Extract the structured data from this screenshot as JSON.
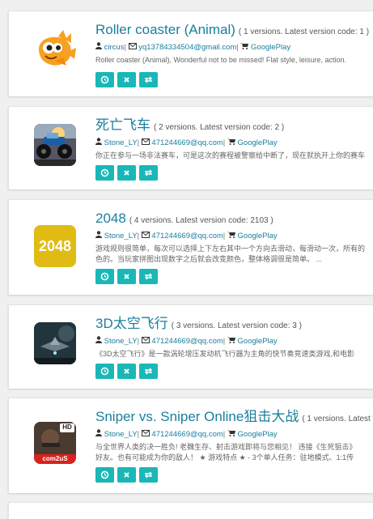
{
  "apps": [
    {
      "title": "Roller coaster (Animal)",
      "versions": "( 1 versions. Latest version code: 1 )",
      "author": "circus",
      "email": "yq13784334504@gmail.com",
      "store": "GooglePlay",
      "desc1": "Roller coaster (Animal), Wonderful not to be missed! Flat style, leisure, action.",
      "desc2": "",
      "icon": "fish-icon"
    },
    {
      "title": "死亡飞车",
      "versions": "( 2 versions. Latest version code: 2 )",
      "author": "Stone_LY",
      "email": "471244669@qq.com",
      "store": "GooglePlay",
      "desc1": "你正在参与一场非法赛车，可是这次的赛程被警察给中断了，现在就执开上你的赛车",
      "desc2": "",
      "icon": "monster-truck-icon"
    },
    {
      "title": "2048",
      "versions": "( 4 versions. Latest version code: 2103 )",
      "author": "Stone_LY",
      "email": "471244669@qq.com",
      "store": "GooglePlay",
      "desc1": "游戏规则很简单，每次可以选择上下左右其中一个方向去滑动，每滑动一次，所有的",
      "desc2": "色的。当玩家拼图出现数字之后就会改变颜色，整体格调很是简单。 ...",
      "icon": "2048-icon",
      "icon_text": "2048"
    },
    {
      "title": "3D太空飞行",
      "versions": "( 3 versions. Latest version code: 3 )",
      "author": "Stone_LY",
      "email": "471244669@qq.com",
      "store": "GooglePlay",
      "desc1": "《3D太空飞行》是一款涡轮增压发动机飞行器为主角的快节奏竞速类游戏,和电影",
      "desc2": "",
      "icon": "spaceship-icon"
    },
    {
      "title": "Sniper vs. Sniper Online狙击大战",
      "versions": "( 1 versions. Latest version",
      "author": "Stone_LY",
      "email": "471244669@qq.com",
      "store": "GooglePlay",
      "desc1": "与全世界人类的决一胜负! 老魏生存、射击游戏即将与您相见！ 违接《生死狙击》",
      "desc2": "好友。也有可能成为你的敌人！ ★ 游戏特点 ★ - 3个单人任务：驻地模式、1:1传",
      "icon": "sniper-icon",
      "icon_badge": "HD",
      "icon_brand": "com2uS"
    }
  ],
  "colors": {
    "accent": "#1a7e9e",
    "button": "#1ab7b7"
  }
}
